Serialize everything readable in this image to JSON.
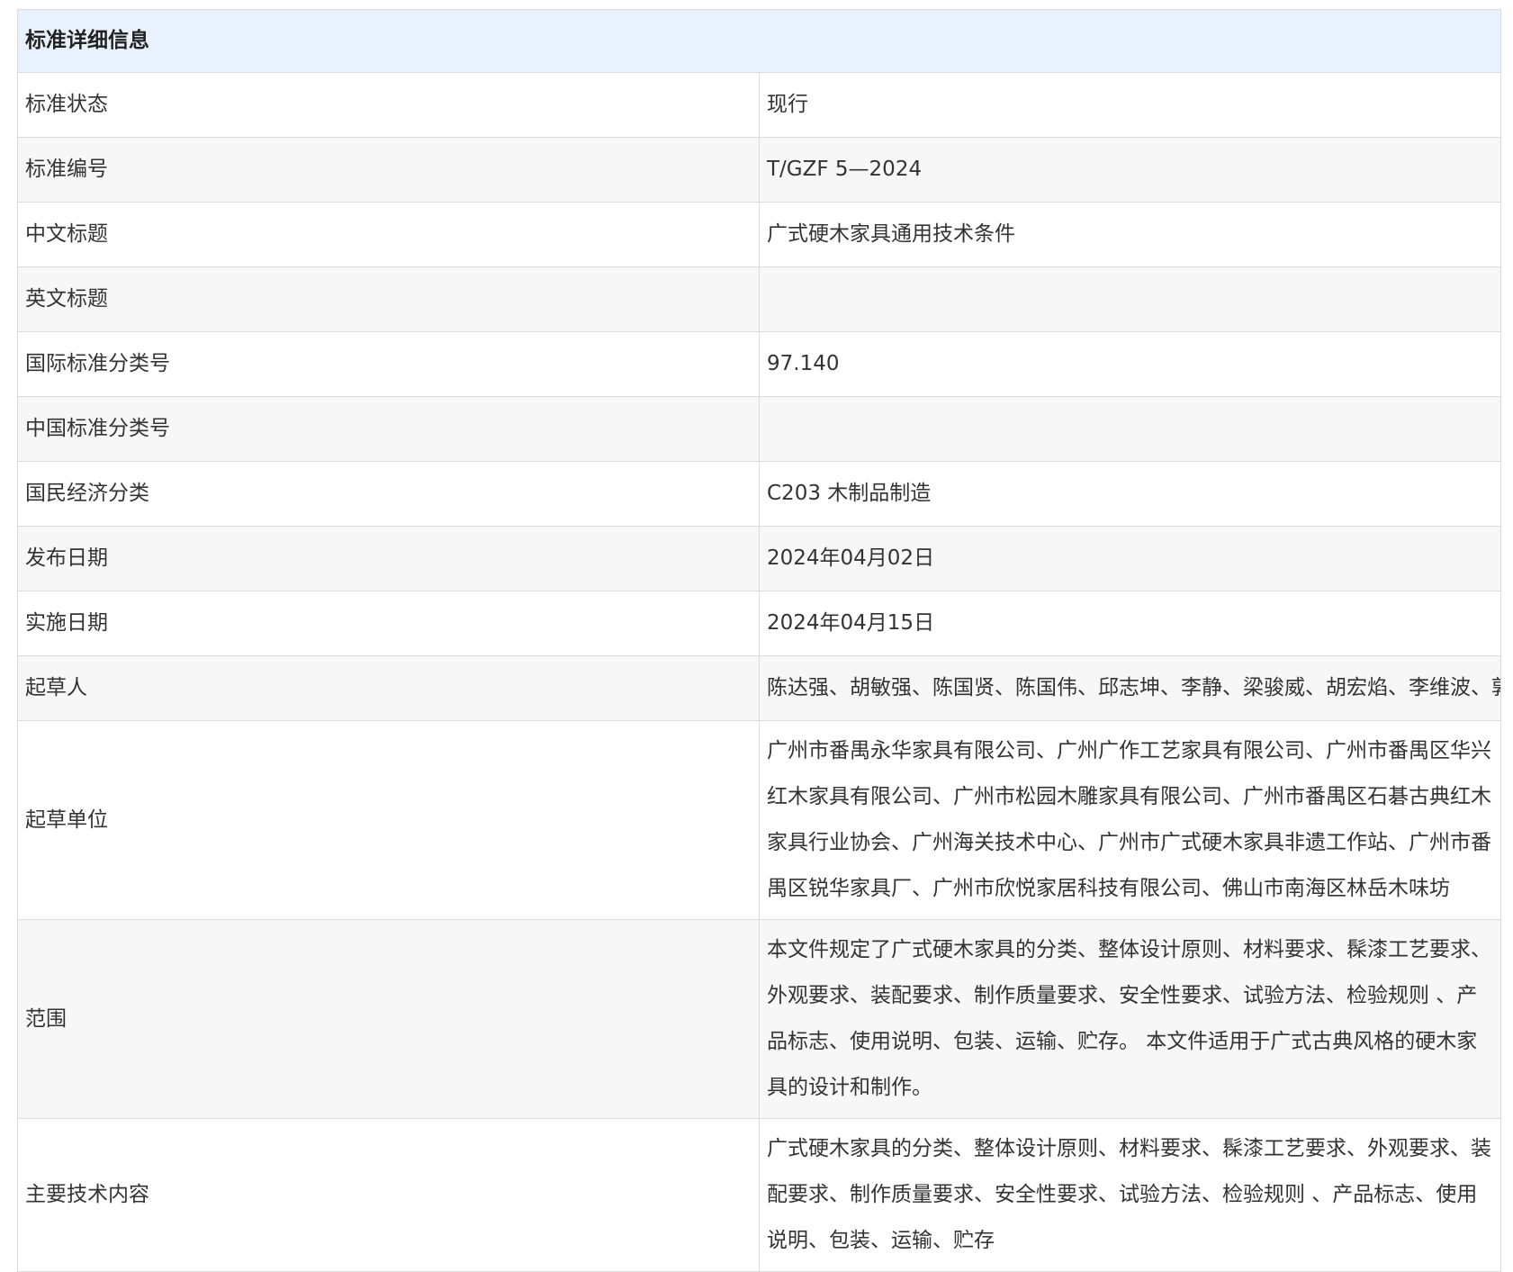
{
  "header": {
    "title": "标准详细信息"
  },
  "rows": [
    {
      "label": "标准状态",
      "value": "现行"
    },
    {
      "label": "标准编号",
      "value": "T/GZF 5—2024"
    },
    {
      "label": "中文标题",
      "value": "广式硬木家具通用技术条件"
    },
    {
      "label": "英文标题",
      "value": ""
    },
    {
      "label": "国际标准分类号",
      "value": "97.140"
    },
    {
      "label": "中国标准分类号",
      "value": ""
    },
    {
      "label": "国民经济分类",
      "value": "C203 木制品制造"
    },
    {
      "label": "发布日期",
      "value": "2024年04月02日"
    },
    {
      "label": "实施日期",
      "value": "2024年04月15日"
    },
    {
      "label": "起草人",
      "value": "陈达强、胡敏强、陈国贤、陈国伟、邱志坤、李静、梁骏威、胡宏焰、李维波、郭琼、黄宇斌、肖海洋、陈希、黄武飞、陈允、杨家辉"
    },
    {
      "label": "起草单位",
      "value": "广州市番禺永华家具有限公司、广州广作工艺家具有限公司、广州市番禺区华兴红木家具有限公司、广州市松园木雕家具有限公司、广州市番禺区石碁古典红木家具行业协会、广州海关技术中心、广州市广式硬木家具非遗工作站、广州市番禺区锐华家具厂、广州市欣悦家居科技有限公司、佛山市南海区林岳木味坊"
    },
    {
      "label": "范围",
      "value": "本文件规定了广式硬木家具的分类、整体设计原则、材料要求、髹漆工艺要求、外观要求、装配要求、制作质量要求、安全性要求、试验方法、检验规则 、产品标志、使用说明、包装、运输、贮存。 本文件适用于广式古典风格的硬木家具的设计和制作。"
    },
    {
      "label": "主要技术内容",
      "value": "广式硬木家具的分类、整体设计原则、材料要求、髹漆工艺要求、外观要求、装配要求、制作质量要求、安全性要求、试验方法、检验规则 、产品标志、使用说明、包装、运输、贮存"
    }
  ]
}
